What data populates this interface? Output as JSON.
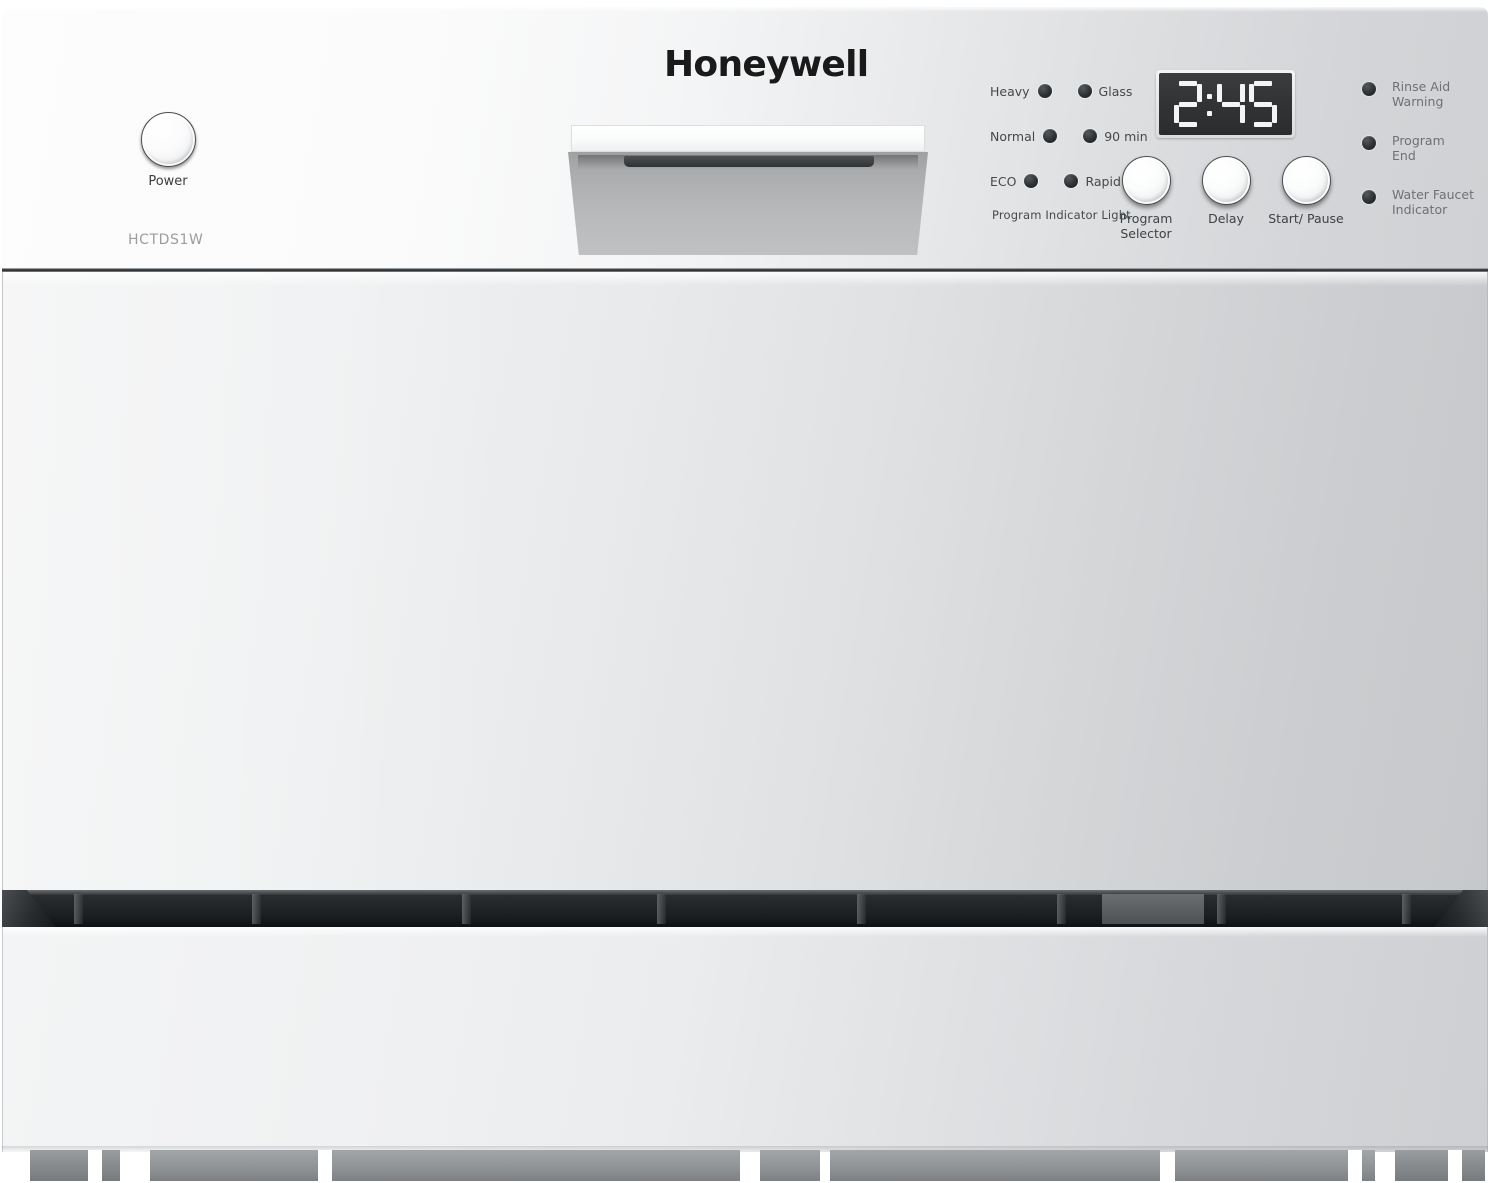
{
  "brand": {
    "logo_text": "Honeywell",
    "model_number": "HCTDS1W"
  },
  "control_panel": {
    "power": {
      "label": "Power",
      "icon": "power-knob"
    },
    "program_indicator_caption": "Program Indicator Light",
    "program_indicators": [
      {
        "left_label": "Heavy",
        "right_label": "Glass",
        "left_led": "led-indicator",
        "right_led": "led-indicator"
      },
      {
        "left_label": "Normal",
        "right_label": "90 min",
        "left_led": "led-indicator",
        "right_led": "led-indicator"
      },
      {
        "left_label": "ECO",
        "right_label": "Rapid",
        "left_led": "led-indicator",
        "right_led": "led-indicator"
      }
    ],
    "display": {
      "value": "2:45",
      "digits": [
        "2",
        ":",
        "4",
        "5"
      ],
      "background_color": "#2e3032",
      "segment_color": "#f2f4f5"
    },
    "knobs": [
      {
        "label": "Program\nSelector",
        "name": "program-selector"
      },
      {
        "label": "Delay",
        "name": "delay"
      },
      {
        "label": "Start/\nPause",
        "name": "start-pause"
      }
    ],
    "status_indicators": [
      {
        "label": "Rinse Aid\nWarning",
        "led": "led-indicator"
      },
      {
        "label": "Program\nEnd",
        "led": "led-indicator"
      },
      {
        "label": "Water Faucet\nIndicator",
        "led": "led-indicator"
      }
    ]
  },
  "door": {
    "handle_name": "door-handle"
  },
  "colors": {
    "panel_light": "#fbfbfb",
    "panel_dark": "#cfd1d4",
    "body_light": "#f1f2f3",
    "body_dark": "#c6c8cb",
    "vent_dark": "#1b1e20",
    "led_dark": "#2d3033",
    "text_primary": "#46494c",
    "text_muted": "#9a9da0"
  }
}
